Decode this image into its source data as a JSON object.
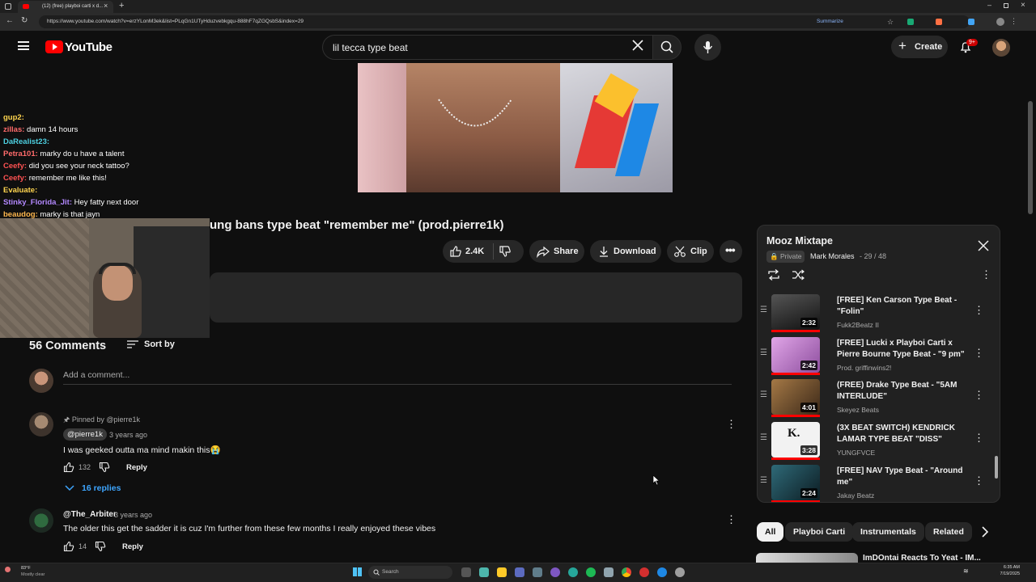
{
  "browser": {
    "tab_title": "(12) (free) playboi carti x d...",
    "url": "https://www.youtube.com/watch?v=erzYLonM3ek&list=PLqGn1UTyHduzvebkgqu-888hF7qZGQsbS&index=29",
    "summarize": "Summarize"
  },
  "header": {
    "logo_text": "YouTube",
    "search_value": "lil tecca type beat",
    "create_label": "Create",
    "notification_count": "9+"
  },
  "chat": [
    {
      "user": "gup2:",
      "message": "",
      "color": "#ffd54f"
    },
    {
      "user": "zillas:",
      "message": "damn 14 hours",
      "color": "#ff6b6b"
    },
    {
      "user": "DaRealist23:",
      "message": "",
      "color": "#4dd0e1"
    },
    {
      "user": "Petra101:",
      "message": "marky do u have a talent",
      "color": "#ff6b6b"
    },
    {
      "user": "Ceefy:",
      "message": "did you see your neck tattoo?",
      "color": "#ff5252"
    },
    {
      "user": "Ceefy:",
      "message": "remember me like this!",
      "color": "#ff5252"
    },
    {
      "user": "Evaluate:",
      "message": "",
      "color": "#ffd54f"
    },
    {
      "user": "Stinky_Florida_Jit:",
      "message": "Hey fatty next door",
      "color": "#b388ff"
    },
    {
      "user": "beaudog:",
      "message": "marky is that jayn",
      "color": "#ffb74d"
    }
  ],
  "video": {
    "title_visible": "ung bans type beat \"remember me\" (prod.pierre1k)",
    "likes": "2.4K",
    "share_label": "Share",
    "download_label": "Download",
    "clip_label": "Clip"
  },
  "comments": {
    "count_label": "56 Comments",
    "sort_label": "Sort by",
    "add_placeholder": "Add a comment...",
    "items": [
      {
        "pinned": "Pinned by @pierre1k",
        "author": "@pierre1k",
        "time": "3 years ago",
        "text": "I was geeked outta ma mind makin this😭",
        "likes": "132",
        "reply": "Reply",
        "replies": "16 replies"
      },
      {
        "author": "@The_Arbiter",
        "time": "3 years ago",
        "text": "The older this get the sadder it is cuz I'm further from these few months I really enjoyed these vibes",
        "likes": "14",
        "reply": "Reply"
      }
    ]
  },
  "playlist": {
    "title": "Mooz Mixtape",
    "privacy": "Private",
    "owner": "Mark Morales",
    "position": "29 / 48",
    "items": [
      {
        "title": "[FREE] Ken Carson Type Beat - \"Folin\"",
        "channel": "Fukk2Beatz II",
        "duration": "2:32",
        "thumb": "#2c2c2c"
      },
      {
        "title": "[FREE] Lucki x Playboi Carti x Pierre Bourne Type Beat - \"9 pm\"",
        "channel": "Prod. griffinwins2!",
        "duration": "2:42",
        "thumb": "#b06fb3"
      },
      {
        "title": "(FREE) Drake Type Beat - \"5AM INTERLUDE\"",
        "channel": "Skeyez Beats",
        "duration": "4:01",
        "thumb": "#6b4a2a"
      },
      {
        "title": "(3X BEAT SWITCH) KENDRICK LAMAR TYPE BEAT \"DISS\"",
        "channel": "YUNGFVCE",
        "duration": "3:28",
        "thumb": "#e8e8e8",
        "thumb_text": "K."
      },
      {
        "title": "[FREE] NAV Type Beat - \"Around me\"",
        "channel": "Jakay Beatz",
        "duration": "2:24",
        "thumb": "#1c3b44"
      }
    ]
  },
  "chips": [
    "All",
    "Playboi Carti",
    "Instrumentals",
    "Related"
  ],
  "next_video_title": "ImDOntai Reacts To Yeat - IM...",
  "taskbar": {
    "weather_temp": "83°F",
    "weather_desc": "Mostly clear",
    "search_label": "Search",
    "time": "6:35 AM",
    "date": "7/19/2025"
  }
}
